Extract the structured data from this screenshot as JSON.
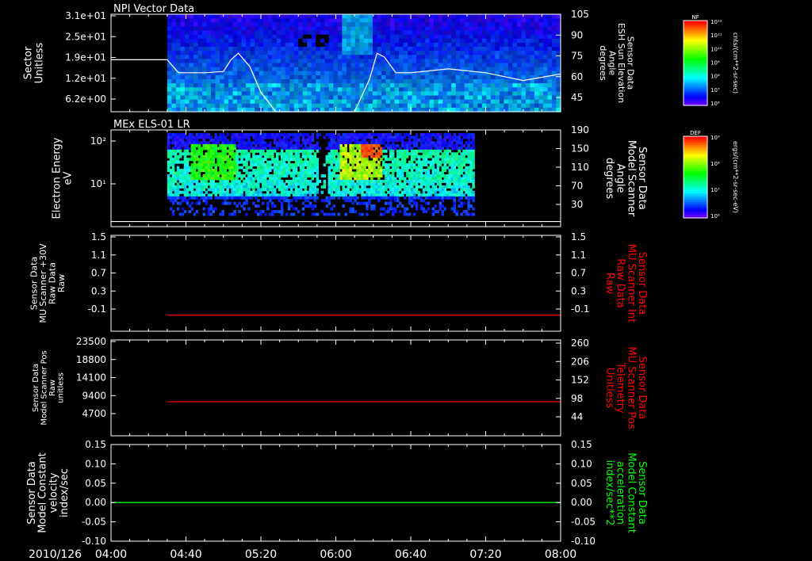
{
  "figure": {
    "date_label": "2010/126",
    "time_ticks": [
      "04:00",
      "04:40",
      "05:20",
      "06:00",
      "06:40",
      "07:20",
      "08:00"
    ],
    "colors": {
      "background": "#000000",
      "axis": "#ffffff",
      "red_trace": "#ff0000",
      "green_trace": "#00ff00",
      "white_trace": "#ffffff"
    }
  },
  "chart_data": [
    {
      "type": "heatmap",
      "panel_title": "NPI Vector Data",
      "ylabel": [
        "Sector",
        "Unitless"
      ],
      "yticks": [
        "3.1e+01",
        "2.5e+01",
        "1.9e+01",
        "1.2e+01",
        "6.2e+00"
      ],
      "right_ylabel": [
        "Sensor Data",
        "ESH Sun Elevation",
        "Angle",
        "degrees"
      ],
      "right_yticks": [
        "105",
        "90",
        "75",
        "60",
        "45"
      ],
      "right_ylim": [
        30,
        105
      ],
      "data_start": "04:30",
      "overlay_line": {
        "x": [
          "04:00",
          "04:30",
          "04:36",
          "04:50",
          "05:00",
          "05:04",
          "05:08",
          "05:14",
          "05:20",
          "05:28",
          "06:10",
          "06:18",
          "06:22",
          "06:26",
          "06:32",
          "06:40",
          "07:00",
          "07:20",
          "07:30",
          "07:40",
          "08:00"
        ],
        "y": [
          70,
          70,
          60,
          60,
          61,
          70,
          75,
          65,
          45,
          30,
          30,
          55,
          75,
          72,
          60,
          60,
          63,
          60,
          57,
          54,
          59
        ]
      },
      "colorbar": {
        "title": "NF",
        "ticks": [
          "10¹²",
          "10¹¹",
          "10¹⁰",
          "10⁹",
          "10⁸",
          "10⁷",
          "10⁶"
        ],
        "units": "cnts/(cm**2-sr-sec)"
      }
    },
    {
      "type": "heatmap",
      "panel_title": "MEx ELS-01 LR",
      "ylabel": [
        "Electron Energy",
        "eV"
      ],
      "yticks": [
        "10²",
        "10¹"
      ],
      "right_ylabel": [
        "Sensor Data",
        "Model Scanner",
        "Angle",
        "degrees"
      ],
      "right_yticks": [
        "190",
        "150",
        "110",
        "70",
        "30"
      ],
      "right_ylim": [
        0,
        190
      ],
      "data_start": "04:30",
      "data_end": "07:14",
      "overlay_line": {
        "x": [
          "04:00",
          "08:00"
        ],
        "y": [
          10,
          10
        ]
      },
      "colorbar": {
        "title": "DEF",
        "ticks": [
          "10⁹",
          "10⁸",
          "10⁷",
          "10⁶"
        ],
        "units": "ergs/(cm**2-sr-sec-eV)"
      }
    },
    {
      "type": "line",
      "ylabel": [
        "Sensor Data",
        "MU Scanner +30V",
        "Raw Data",
        "Raw"
      ],
      "yticks": [
        "1.5",
        "1.1",
        "0.7",
        "0.3",
        "-0.1"
      ],
      "right_ylabel": [
        "Sensor Data",
        "MU Scanner Int",
        "Raw Data",
        "Raw"
      ],
      "right_yticks": [
        "1.5",
        "1.1",
        "0.7",
        "0.3",
        "-0.1"
      ],
      "ylim": [
        -0.35,
        1.5
      ],
      "series": [
        {
          "x": [
            "04:30",
            "08:00"
          ],
          "y": [
            -0.04,
            -0.04
          ],
          "color": "#ff0000"
        }
      ]
    },
    {
      "type": "line",
      "ylabel": [
        "Sensor Data",
        "Model Scanner Pos",
        "Raw",
        "unitless"
      ],
      "yticks": [
        "23500",
        "18800",
        "14100",
        "9400",
        "4700"
      ],
      "right_ylabel": [
        "Sensor Data",
        "MU Scanner Pos",
        "Telemetry",
        "Unitless"
      ],
      "right_yticks": [
        "260",
        "206",
        "152",
        "98",
        "44"
      ],
      "ylim": [
        0,
        23500
      ],
      "series": [
        {
          "x": [
            "04:30",
            "08:00"
          ],
          "y": [
            8350,
            8350
          ],
          "color": "#ff0000"
        }
      ]
    },
    {
      "type": "line",
      "ylabel": [
        "Sensor Data",
        "Model Constant",
        "velocity",
        "index/sec"
      ],
      "yticks": [
        "0.15",
        "0.10",
        "0.05",
        "0.00",
        "-0.05",
        "-0.10"
      ],
      "right_ylabel": [
        "Sensor Data",
        "Model Constant",
        "acceleration",
        "index/sec**2"
      ],
      "right_yticks": [
        "0.15",
        "0.10",
        "0.05",
        "0.00",
        "-0.05",
        "-0.10"
      ],
      "ylim": [
        -0.1,
        0.15
      ],
      "series": [
        {
          "x": [
            "04:00",
            "08:00"
          ],
          "y": [
            0,
            0
          ],
          "color": "#00ff00"
        }
      ]
    }
  ]
}
